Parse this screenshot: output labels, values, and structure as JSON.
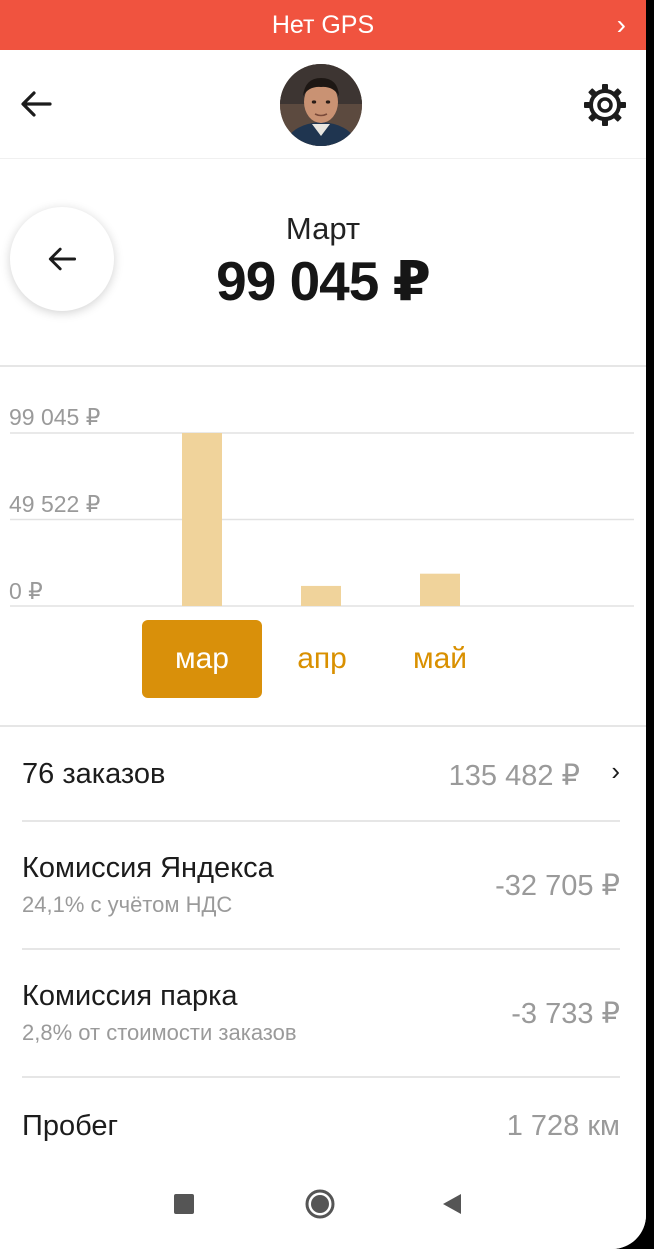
{
  "banner": {
    "text": "Нет GPS"
  },
  "summary": {
    "month": "Март",
    "total": "99 045 ₽"
  },
  "chart_data": {
    "type": "bar",
    "categories": [
      "мар",
      "апр",
      "май"
    ],
    "values": [
      99045,
      11500,
      18500
    ],
    "selected": "мар",
    "y_ticks": [
      "99 045 ₽",
      "49 522 ₽",
      "0 ₽"
    ],
    "ylim": [
      0,
      99045
    ],
    "bar_color": "#f0d39b",
    "grid": true
  },
  "stats": {
    "orders": {
      "label": "76 заказов",
      "value": "135 482 ₽"
    },
    "yandex_fee": {
      "label": "Комиссия Яндекса",
      "sub": "24,1% с учётом НДС",
      "value": "-32 705 ₽"
    },
    "park_fee": {
      "label": "Комиссия парка",
      "sub": "2,8% от стоимости заказов",
      "value": "-3 733 ₽"
    },
    "mileage": {
      "label": "Пробег",
      "value": "1 728 км"
    }
  },
  "colors": {
    "banner": "#f0533f",
    "accent": "#d9900a",
    "bar": "#f0d39b"
  }
}
